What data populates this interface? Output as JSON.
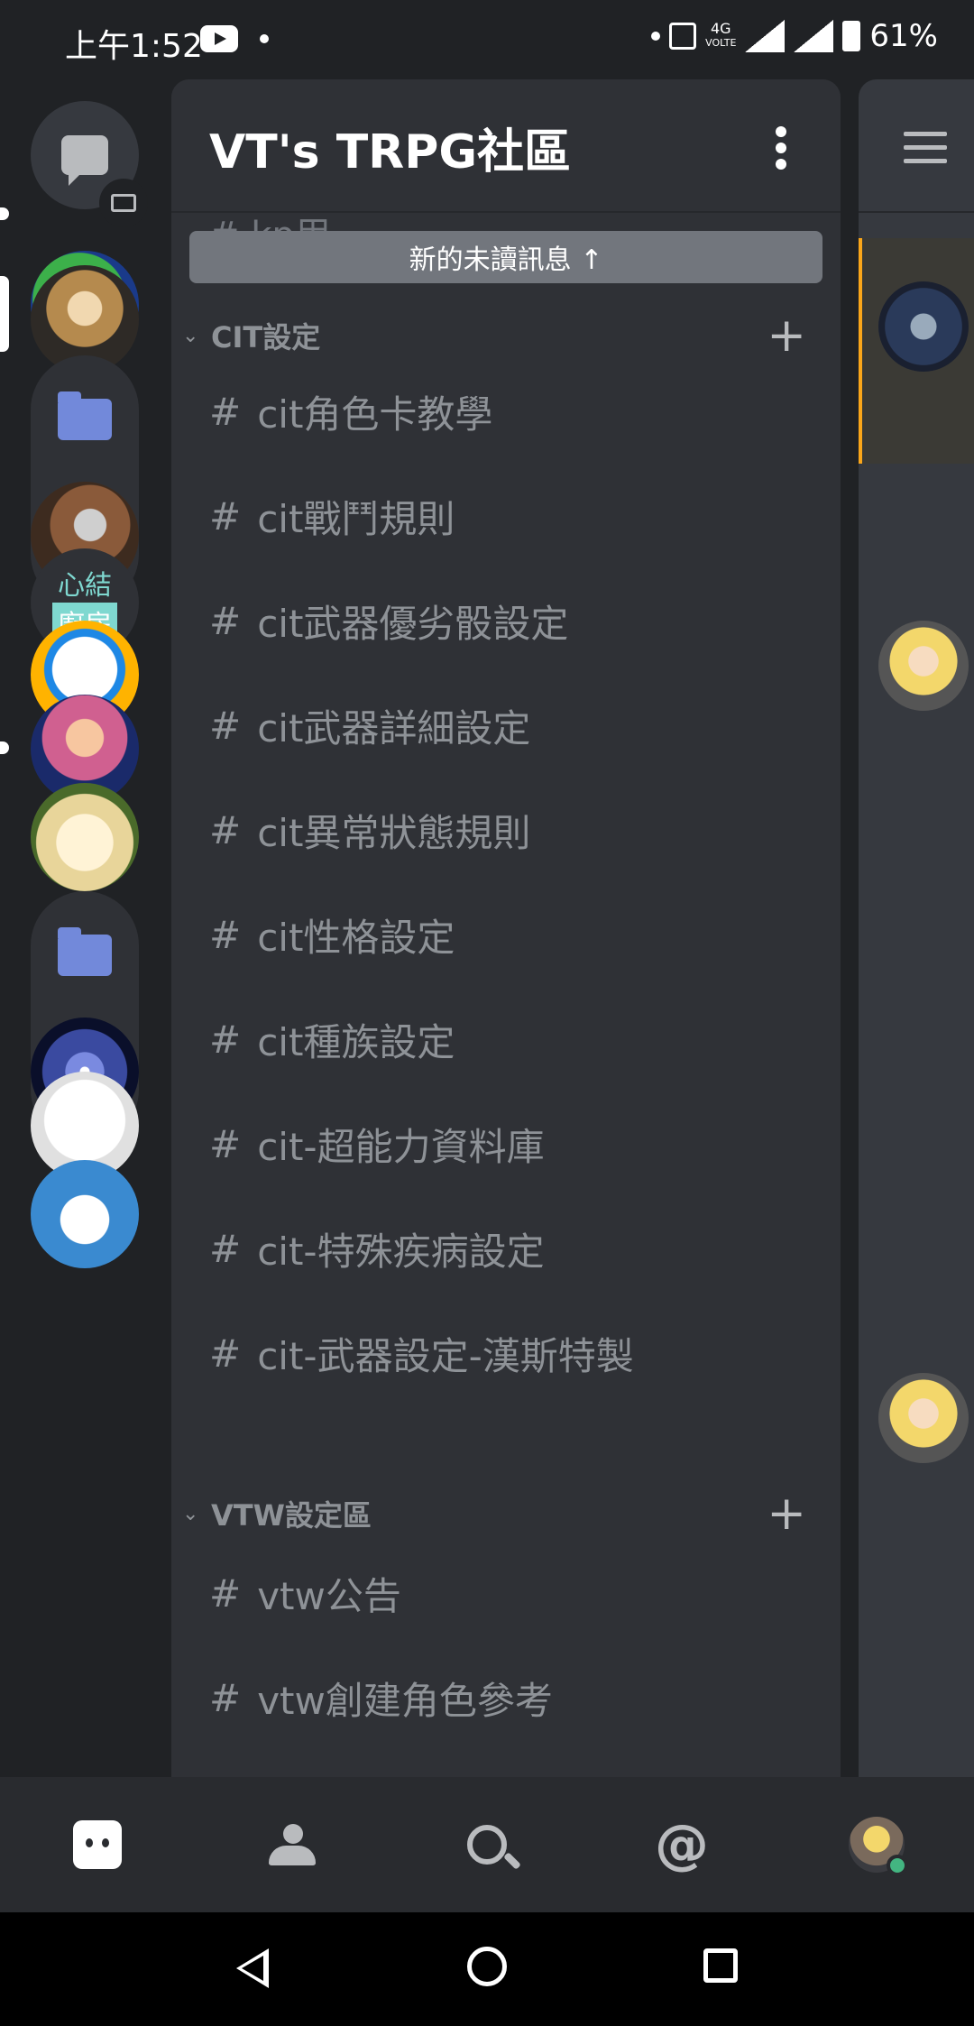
{
  "status_bar": {
    "time": "上午1:52",
    "network": "4G",
    "network_sub": "VOLTE",
    "sim1": "1",
    "sim2": "2",
    "battery": "61%"
  },
  "server": {
    "name": "VT's TRPG社區",
    "peek_channel": "# kp用"
  },
  "unread_banner": "新的未讀訊息 ↑",
  "categories": [
    {
      "label": "CIT設定",
      "channels": [
        "cit角色卡教學",
        "cit戰鬥規則",
        "cit武器優劣骰設定",
        "cit武器詳細設定",
        "cit異常狀態規則",
        "cit性格設定",
        "cit種族設定",
        "cit-超能力資料庫",
        "cit-特殊疾病設定",
        "cit-武器設定-漢斯特製"
      ]
    },
    {
      "label": "VTW設定區",
      "channels": [
        "vtw公告",
        "vtw創建角色參考"
      ]
    }
  ],
  "servers": [
    {
      "name": "dm",
      "icon": "chat-bubble-icon"
    },
    {
      "name": "server-stickman",
      "color": "#f2c200"
    },
    {
      "name": "server-character-hat",
      "color": "#a07a3c"
    },
    {
      "name": "folder-1",
      "icon": "folder-icon"
    },
    {
      "name": "server-dice",
      "color": "#7a5a3a"
    },
    {
      "name": "server-kitchen",
      "label_top": "心結",
      "label_bottom": "廚房"
    },
    {
      "name": "server-robot",
      "color": "#1e88e5"
    },
    {
      "name": "server-anime-girl",
      "color": "#d06090"
    },
    {
      "name": "server-hamster",
      "color": "#e8d59a"
    },
    {
      "name": "folder-2",
      "icon": "folder-icon"
    },
    {
      "name": "server-galaxy",
      "color": "#3a4aa0"
    },
    {
      "name": "server-cat",
      "color": "#ffffff"
    },
    {
      "name": "server-doraemon",
      "color": "#3a8ad0"
    }
  ],
  "bottom_nav": [
    "home-icon",
    "friends-icon",
    "search-icon",
    "mentions-icon",
    "profile-avatar"
  ],
  "colors": {
    "background": "#202225",
    "panel": "#2f3136",
    "accent": "#7289da",
    "online": "#43b581",
    "highlight": "#faa61a"
  }
}
